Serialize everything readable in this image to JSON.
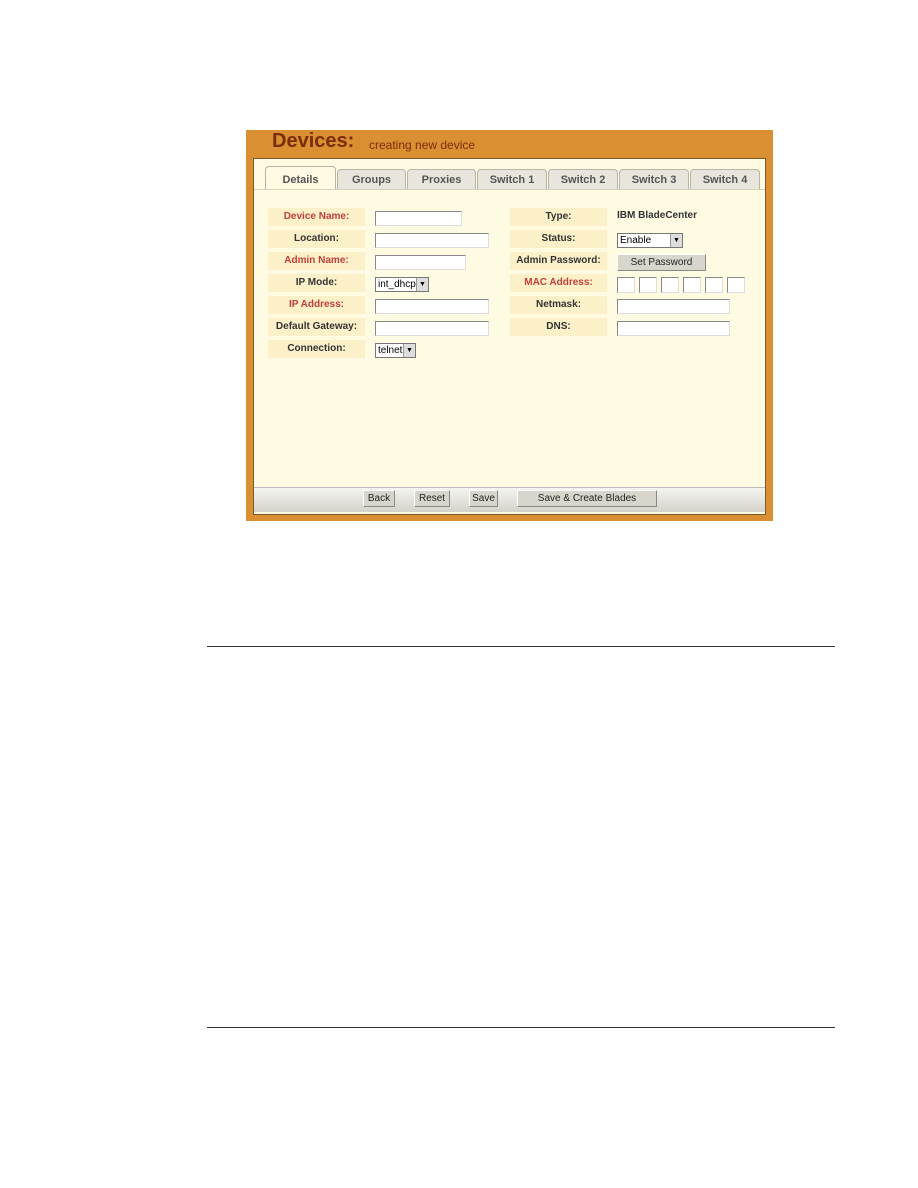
{
  "header": {
    "title": "Devices:",
    "subtitle": "creating new device"
  },
  "tabs": [
    "Details",
    "Groups",
    "Proxies",
    "Switch 1",
    "Switch 2",
    "Switch 3",
    "Switch 4"
  ],
  "active_tab": "Details",
  "form": {
    "device_name": {
      "label": "Device Name:",
      "value": ""
    },
    "location": {
      "label": "Location:",
      "value": ""
    },
    "admin_name": {
      "label": "Admin Name:",
      "value": ""
    },
    "ip_mode": {
      "label": "IP Mode:",
      "value": "int_dhcp"
    },
    "ip_address": {
      "label": "IP Address:",
      "value": ""
    },
    "default_gateway": {
      "label": "Default Gateway:",
      "value": ""
    },
    "connection": {
      "label": "Connection:",
      "value": "telnet"
    },
    "type": {
      "label": "Type:",
      "value": "IBM BladeCenter"
    },
    "status": {
      "label": "Status:",
      "value": "Enable"
    },
    "admin_password": {
      "label": "Admin Password:",
      "button": "Set Password"
    },
    "mac_address": {
      "label": "MAC Address:"
    },
    "netmask": {
      "label": "Netmask:",
      "value": ""
    },
    "dns": {
      "label": "DNS:",
      "value": ""
    }
  },
  "buttons": {
    "back": "Back",
    "reset": "Reset",
    "save": "Save",
    "save_create": "Save & Create Blades"
  },
  "colors": {
    "header": "#d98f32",
    "panel": "#fffbe3",
    "required_label": "#c0403a"
  }
}
